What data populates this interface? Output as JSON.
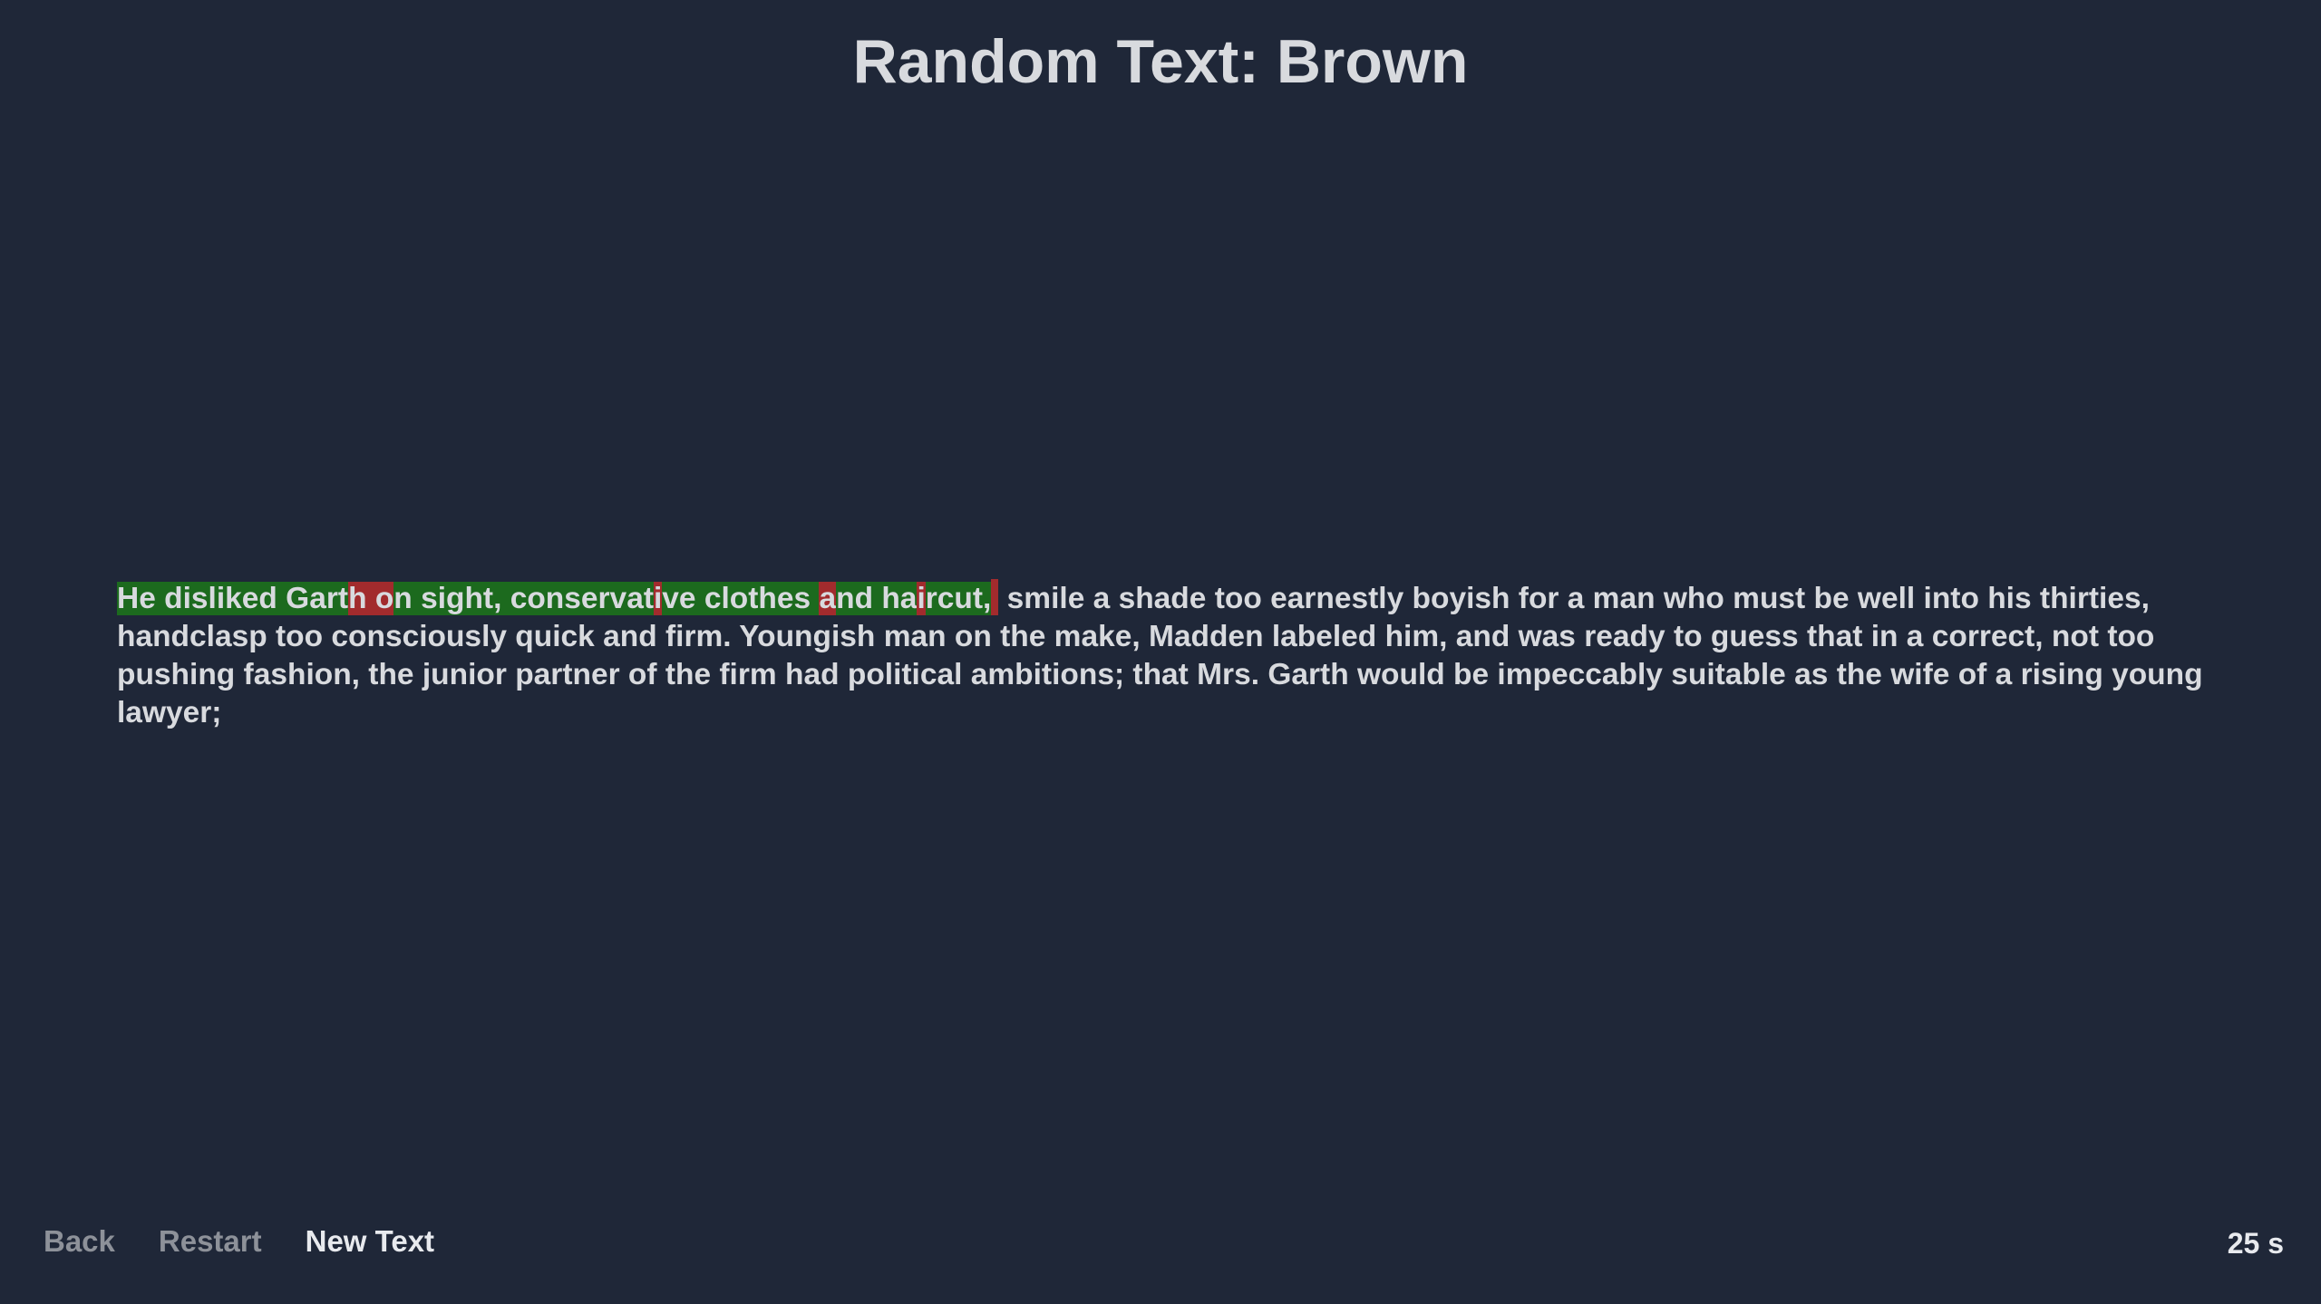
{
  "title": "Random Text: Brown",
  "text_segments": [
    {
      "text": "He disliked Gart",
      "state": "correct"
    },
    {
      "text": "h o",
      "state": "wrong"
    },
    {
      "text": "n sight, conservat",
      "state": "correct"
    },
    {
      "text": "i",
      "state": "wrong"
    },
    {
      "text": "ve clothes ",
      "state": "correct"
    },
    {
      "text": "a",
      "state": "wrong"
    },
    {
      "text": "nd ha",
      "state": "correct"
    },
    {
      "text": "i",
      "state": "wrong"
    },
    {
      "text": "rcut,",
      "state": "correct"
    },
    {
      "text": "",
      "state": "caret-wrong"
    },
    {
      "text": " smile a shade too earnestly boyish for a man who must be well into his thirties, handclasp too consciously quick and firm. Youngish man on the make, Madden labeled him, and was ready to guess that in a correct, not too pushing fashion, the junior partner of the firm had political ambitions; that Mrs. Garth would be impeccably suitable as the wife of a rising young lawyer;",
      "state": "pending"
    }
  ],
  "footer": {
    "back_label": "Back",
    "restart_label": "Restart",
    "new_text_label": "New Text"
  },
  "timer": "25 s",
  "colors": {
    "background": "#1f2738",
    "correct": "#1c6a1e",
    "wrong": "#a22b2d",
    "text": "#d8dade"
  }
}
